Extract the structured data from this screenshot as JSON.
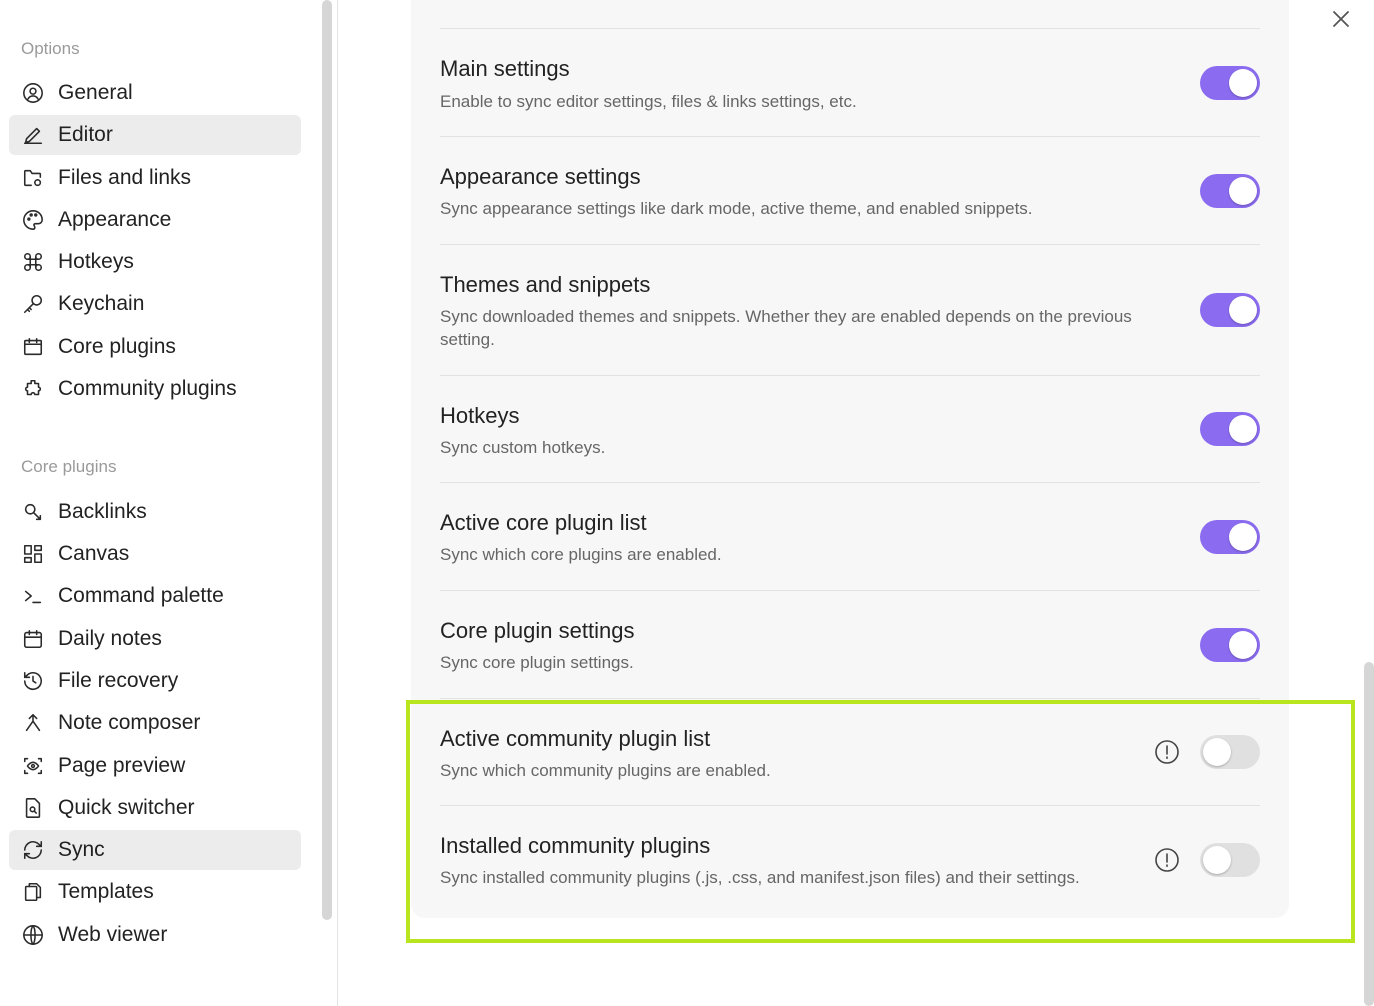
{
  "sidebar": {
    "options_title": "Options",
    "options_items": [
      {
        "label": "General",
        "icon": "user-circle-icon"
      },
      {
        "label": "Editor",
        "icon": "pencil-icon"
      },
      {
        "label": "Files and links",
        "icon": "folder-cog-icon"
      },
      {
        "label": "Appearance",
        "icon": "palette-icon"
      },
      {
        "label": "Hotkeys",
        "icon": "command-icon"
      },
      {
        "label": "Keychain",
        "icon": "key-icon"
      },
      {
        "label": "Core plugins",
        "icon": "calendar-box-icon"
      },
      {
        "label": "Community plugins",
        "icon": "puzzle-icon"
      }
    ],
    "core_title": "Core plugins",
    "core_items": [
      {
        "label": "Backlinks",
        "icon": "backlink-icon"
      },
      {
        "label": "Canvas",
        "icon": "layout-dashboard-icon"
      },
      {
        "label": "Command palette",
        "icon": "terminal-icon"
      },
      {
        "label": "Daily notes",
        "icon": "calendar-icon"
      },
      {
        "label": "File recovery",
        "icon": "history-icon"
      },
      {
        "label": "Note composer",
        "icon": "merge-icon"
      },
      {
        "label": "Page preview",
        "icon": "scan-eye-icon"
      },
      {
        "label": "Quick switcher",
        "icon": "file-search-icon"
      },
      {
        "label": "Sync",
        "icon": "refresh-icon"
      },
      {
        "label": "Templates",
        "icon": "files-icon"
      },
      {
        "label": "Web viewer",
        "icon": "globe-icon"
      }
    ],
    "active_option": "Editor",
    "active_core": "Sync"
  },
  "settings": [
    {
      "name": "Main settings",
      "desc": "Enable to sync editor settings, files & links settings, etc.",
      "enabled": true,
      "warning": false
    },
    {
      "name": "Appearance settings",
      "desc": "Sync appearance settings like dark mode, active theme, and enabled snippets.",
      "enabled": true,
      "warning": false
    },
    {
      "name": "Themes and snippets",
      "desc": "Sync downloaded themes and snippets. Whether they are enabled depends on the previous setting.",
      "enabled": true,
      "warning": false
    },
    {
      "name": "Hotkeys",
      "desc": "Sync custom hotkeys.",
      "enabled": true,
      "warning": false
    },
    {
      "name": "Active core plugin list",
      "desc": "Sync which core plugins are enabled.",
      "enabled": true,
      "warning": false
    },
    {
      "name": "Core plugin settings",
      "desc": "Sync core plugin settings.",
      "enabled": true,
      "warning": false
    },
    {
      "name": "Active community plugin list",
      "desc": "Sync which community plugins are enabled.",
      "enabled": false,
      "warning": true
    },
    {
      "name": "Installed community plugins",
      "desc": "Sync installed community plugins (.js, .css, and manifest.json files) and their settings.",
      "enabled": false,
      "warning": true
    }
  ],
  "colors": {
    "accent": "#8b6cf0",
    "highlight": "#b8e51e"
  }
}
